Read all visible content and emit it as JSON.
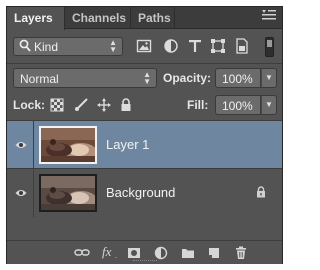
{
  "tabs": [
    {
      "label": "Layers",
      "active": true
    },
    {
      "label": "Channels",
      "active": false
    },
    {
      "label": "Paths",
      "active": false
    }
  ],
  "filter": {
    "kind_label": "Kind",
    "kind_icon": "search-icon",
    "filter_icons": [
      "pixel-layer-filter-icon",
      "adjustment-layer-filter-icon",
      "type-layer-filter-icon",
      "shape-layer-filter-icon",
      "smart-object-filter-icon"
    ]
  },
  "blend": {
    "mode": "Normal",
    "opacity_label": "Opacity:",
    "opacity_value": "100%"
  },
  "lock": {
    "label": "Lock:",
    "icons": [
      "lock-transparent-pixels-icon",
      "lock-image-pixels-icon",
      "lock-position-icon",
      "lock-all-icon"
    ],
    "fill_label": "Fill:",
    "fill_value": "100%"
  },
  "layers": [
    {
      "name": "Layer 1",
      "visible": true,
      "selected": true,
      "locked": false
    },
    {
      "name": "Background",
      "visible": true,
      "selected": false,
      "locked": true
    }
  ],
  "footer_icons": [
    "link-layers-icon",
    "layer-style-fx-icon",
    "add-mask-icon",
    "new-adjustment-layer-icon",
    "new-group-icon",
    "new-layer-icon",
    "delete-layer-icon"
  ],
  "footer": {
    "fx_label": "fx"
  },
  "colors": {
    "panel_bg": "#535353",
    "selected_row": "#6e86a0",
    "tab_bar": "#3c3c3c"
  }
}
